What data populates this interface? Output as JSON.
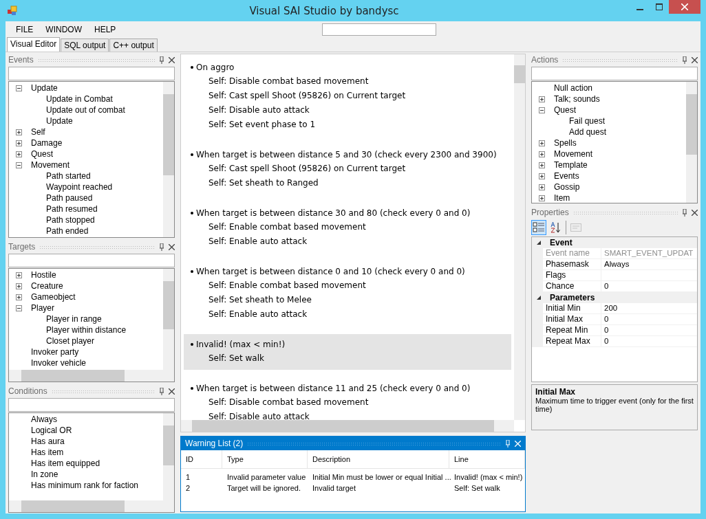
{
  "window": {
    "title": "Visual SAI Studio by bandysc"
  },
  "menu": [
    "FILE",
    "WINDOW",
    "HELP"
  ],
  "tabs": [
    {
      "label": "Visual Editor",
      "selected": true
    },
    {
      "label": "SQL output",
      "selected": false
    },
    {
      "label": "C++ output",
      "selected": false
    }
  ],
  "left_panels": [
    {
      "title": "Events",
      "tree": [
        {
          "label": "Update",
          "expanded": true,
          "children": [
            {
              "label": "Update in Combat"
            },
            {
              "label": "Update out of combat"
            },
            {
              "label": "Update"
            }
          ]
        },
        {
          "label": "Self",
          "expanded": false
        },
        {
          "label": "Damage",
          "expanded": false
        },
        {
          "label": "Quest",
          "expanded": false
        },
        {
          "label": "Movement",
          "expanded": true,
          "children": [
            {
              "label": "Path started"
            },
            {
              "label": "Waypoint reached"
            },
            {
              "label": "Path paused"
            },
            {
              "label": "Path resumed"
            },
            {
              "label": "Path stopped"
            },
            {
              "label": "Path ended"
            }
          ]
        }
      ]
    },
    {
      "title": "Targets",
      "tree": [
        {
          "label": "Hostile",
          "expanded": false
        },
        {
          "label": "Creature",
          "expanded": false
        },
        {
          "label": "Gameobject",
          "expanded": false
        },
        {
          "label": "Player",
          "expanded": true,
          "children": [
            {
              "label": "Player in range"
            },
            {
              "label": "Player within distance"
            },
            {
              "label": "Closet player"
            }
          ]
        },
        {
          "label": "Invoker party"
        },
        {
          "label": "Invoker vehicle"
        }
      ]
    },
    {
      "title": "Conditions",
      "tree": [
        {
          "label": "Always"
        },
        {
          "label": "Logical OR"
        },
        {
          "label": "Has aura"
        },
        {
          "label": "Has item"
        },
        {
          "label": "Has item equipped"
        },
        {
          "label": "In zone"
        },
        {
          "label": "Has minimum rank for faction"
        }
      ]
    }
  ],
  "script": {
    "blocks": [
      {
        "event": "On aggro",
        "selected": false,
        "actions": [
          "Self: Disable combat based movement",
          "Self: Cast spell Shoot (95826) on Current target",
          "Self: Disable auto attack",
          "Self: Set event phase to 1"
        ]
      },
      {
        "event": "When target is between distance 5 and 30 (check every 2300 and 3900)",
        "selected": false,
        "actions": [
          "Self: Cast spell Shoot (95826) on Current target",
          "Self: Set sheath to Ranged"
        ]
      },
      {
        "event": "When target is between distance 30 and 80 (check every 0 and 0)",
        "selected": false,
        "actions": [
          "Self: Enable combat based movement",
          "Self: Enable auto attack"
        ]
      },
      {
        "event": "When target is between distance 0 and 10 (check every 0 and 0)",
        "selected": false,
        "actions": [
          "Self: Enable combat based movement",
          "Self: Set sheath to Melee",
          "Self: Enable auto attack"
        ]
      },
      {
        "event": "Invalid! (max < min!)",
        "selected": true,
        "actions": [
          "Self: Set walk"
        ]
      },
      {
        "event": "When target is between distance 11 and 25 (check every 0 and 0)",
        "selected": false,
        "actions": [
          "Self: Disable combat based movement",
          "Self: Disable auto attack"
        ]
      }
    ]
  },
  "actions_panel": {
    "title": "Actions",
    "tree": [
      {
        "label": "Null action"
      },
      {
        "label": "Talk; sounds",
        "expanded": false
      },
      {
        "label": "Quest",
        "expanded": true,
        "children": [
          {
            "label": "Fail quest"
          },
          {
            "label": "Add quest"
          }
        ]
      },
      {
        "label": "Spells",
        "expanded": false
      },
      {
        "label": "Movement",
        "expanded": false
      },
      {
        "label": "Template",
        "expanded": false
      },
      {
        "label": "Events",
        "expanded": false
      },
      {
        "label": "Gossip",
        "expanded": false
      },
      {
        "label": "Item",
        "expanded": false
      }
    ]
  },
  "properties": {
    "title": "Properties",
    "toolbar": [
      {
        "kind": "categorized",
        "selected": true,
        "disabled": false
      },
      {
        "kind": "alphabetical",
        "selected": false,
        "disabled": false
      },
      {
        "kind": "pages",
        "selected": false,
        "disabled": true
      }
    ],
    "categories": [
      {
        "name": "Event",
        "expanded": true,
        "rows": [
          {
            "name": "Event name",
            "value": "SMART_EVENT_UPDAT",
            "readonly": true
          },
          {
            "name": "Phasemask",
            "value": "Always",
            "readonly": false
          },
          {
            "name": "Flags",
            "value": "",
            "readonly": false
          },
          {
            "name": "Chance",
            "value": "0",
            "readonly": false
          }
        ]
      },
      {
        "name": "Parameters",
        "expanded": true,
        "rows": [
          {
            "name": "Initial Min",
            "value": "200",
            "readonly": false
          },
          {
            "name": "Initial Max",
            "value": "0",
            "readonly": false
          },
          {
            "name": "Repeat Min",
            "value": "0",
            "readonly": false
          },
          {
            "name": "Repeat Max",
            "value": "0",
            "readonly": false
          }
        ]
      }
    ],
    "help": {
      "title": "Initial Max",
      "text": "Maximum time to trigger event (only for the first time)"
    }
  },
  "warnings": {
    "title": "Warning List (2)",
    "columns": [
      "ID",
      "Type",
      "Description",
      "Line"
    ],
    "rows": [
      [
        "1",
        "Invalid parameter value",
        "Initial Min must be lower or equal Initial ...",
        "Invalid! (max < min!)"
      ],
      [
        "2",
        "Target will be ignored.",
        "Invalid target",
        "Self: Set walk"
      ]
    ]
  }
}
